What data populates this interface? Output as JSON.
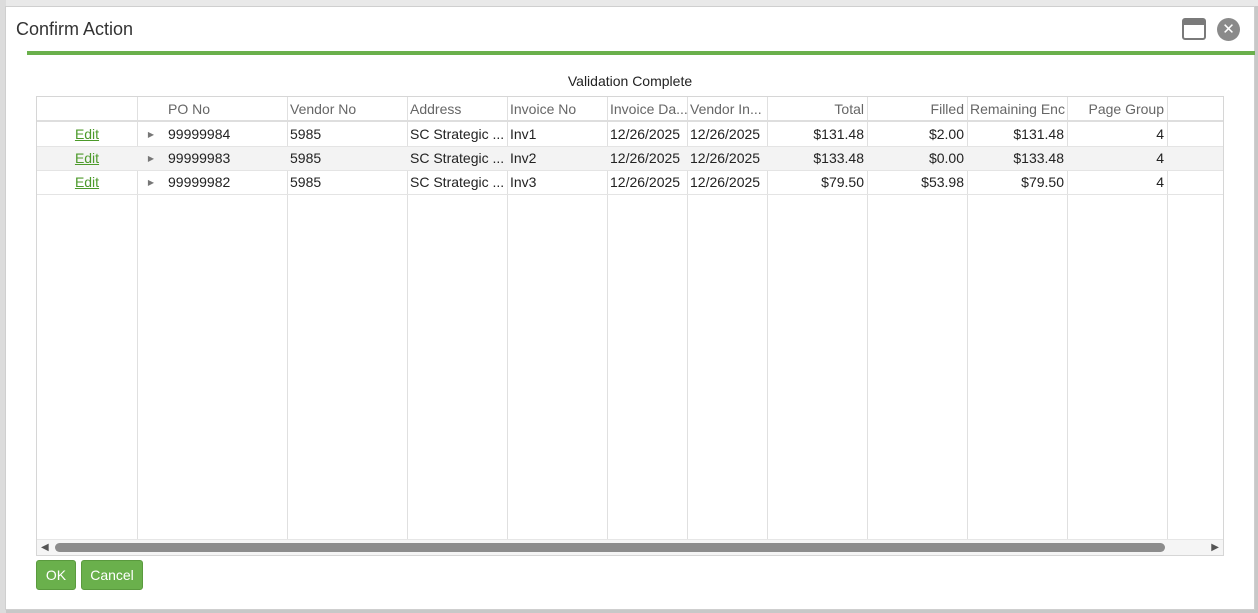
{
  "dialog": {
    "title": "Confirm Action",
    "caption": "Validation Complete",
    "ok_label": "OK",
    "cancel_label": "Cancel",
    "close_glyph": "✕",
    "accent_color": "#6ab04c"
  },
  "grid": {
    "columns": [
      "",
      "",
      "PO No",
      "Vendor No",
      "Address",
      "Invoice No",
      "Invoice Da...",
      "Vendor In...",
      "Total",
      "Filled",
      "Remaining Enc",
      "Page Group"
    ],
    "rows": [
      {
        "edit": "Edit",
        "po_no": "99999984",
        "vendor_no": "5985",
        "address": "SC Strategic ...",
        "invoice_no": "Inv1",
        "invoice_date": "12/26/2025",
        "vendor_invoice": "12/26/2025",
        "total": "$131.48",
        "filled": "$2.00",
        "remaining_enc": "$131.48",
        "page_group": "4"
      },
      {
        "edit": "Edit",
        "po_no": "99999983",
        "vendor_no": "5985",
        "address": "SC Strategic ...",
        "invoice_no": "Inv2",
        "invoice_date": "12/26/2025",
        "vendor_invoice": "12/26/2025",
        "total": "$133.48",
        "filled": "$0.00",
        "remaining_enc": "$133.48",
        "page_group": "4"
      },
      {
        "edit": "Edit",
        "po_no": "99999982",
        "vendor_no": "5985",
        "address": "SC Strategic ...",
        "invoice_no": "Inv3",
        "invoice_date": "12/26/2025",
        "vendor_invoice": "12/26/2025",
        "total": "$79.50",
        "filled": "$53.98",
        "remaining_enc": "$79.50",
        "page_group": "4"
      }
    ]
  }
}
